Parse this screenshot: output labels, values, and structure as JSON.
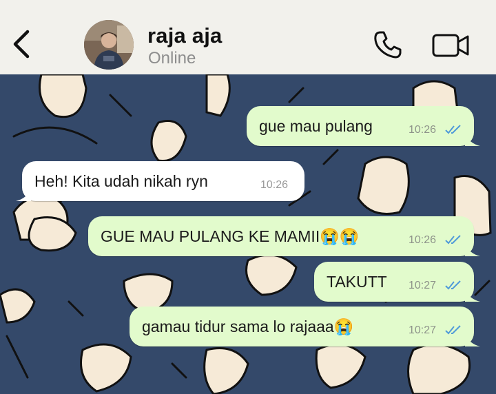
{
  "header": {
    "contact_name": "raja aja",
    "status": "Online"
  },
  "icons": {
    "back": "chevron-left-icon",
    "call": "phone-icon",
    "video": "video-camera-icon",
    "read_receipt": "double-check-icon"
  },
  "colors": {
    "header_bg": "#f2f1ec",
    "chat_bg": "#34496a",
    "outgoing_bubble": "#e2fbcc",
    "incoming_bubble": "#ffffff",
    "read_tick": "#4f9ad9"
  },
  "messages": [
    {
      "direction": "outgoing",
      "text": "gue mau pulang",
      "time": "10:26"
    },
    {
      "direction": "incoming",
      "text": "Heh! Kita udah nikah ryn",
      "time": "10:26"
    },
    {
      "direction": "outgoing",
      "text": "GUE MAU PULANG KE MAMII😭😭",
      "time": "10:26"
    },
    {
      "direction": "outgoing",
      "text": "TAKUTT",
      "time": "10:27"
    },
    {
      "direction": "outgoing",
      "text": "gamau tidur sama lo rajaaa😭",
      "time": "10:27"
    }
  ]
}
